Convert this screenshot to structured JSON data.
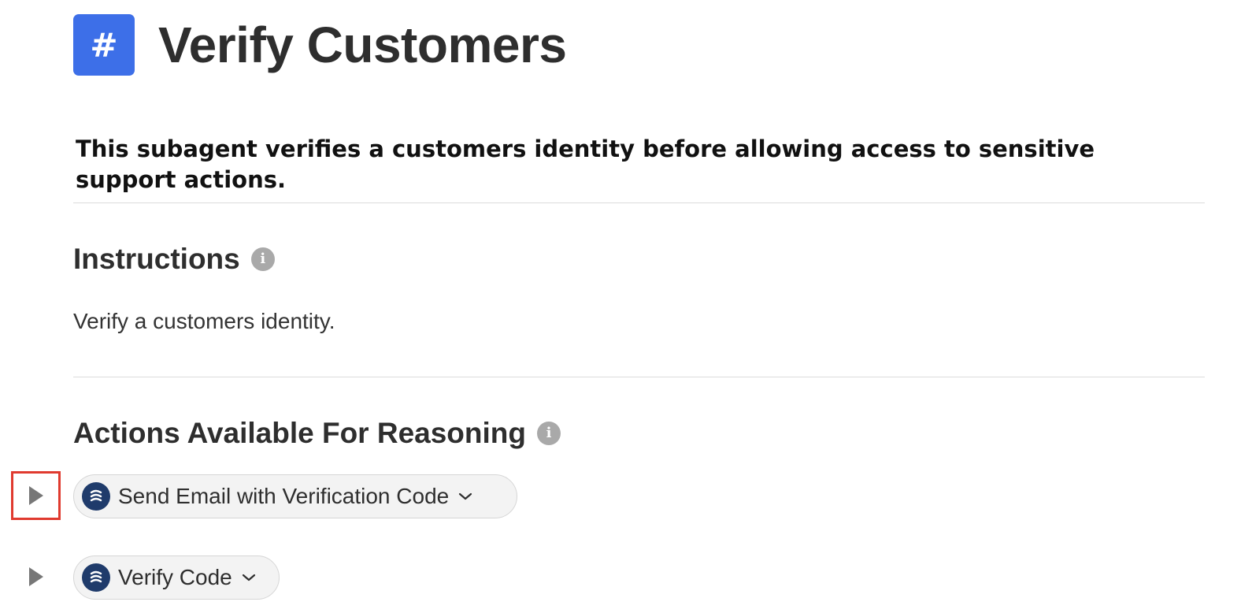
{
  "header": {
    "icon_glyph": "#",
    "icon_name": "hash-icon",
    "icon_color": "#3d6fe8",
    "title": "Verify Customers"
  },
  "description": "This subagent verifies a customers identity before allowing access to sensitive support actions.",
  "instructions": {
    "heading": "Instructions",
    "info_glyph": "i",
    "text": "Verify a customers identity."
  },
  "actions": {
    "heading": "Actions Available For Reasoning",
    "info_glyph": "i",
    "items": [
      {
        "label": "Send Email with Verification Code",
        "icon": "flow-icon",
        "expanded": false,
        "highlighted": true
      },
      {
        "label": "Verify Code",
        "icon": "flow-icon",
        "expanded": false,
        "highlighted": false
      }
    ]
  },
  "colors": {
    "highlight": "#e03a2f",
    "action_icon_bg": "#1f3b6b",
    "info_icon": "#a9a9a9"
  }
}
